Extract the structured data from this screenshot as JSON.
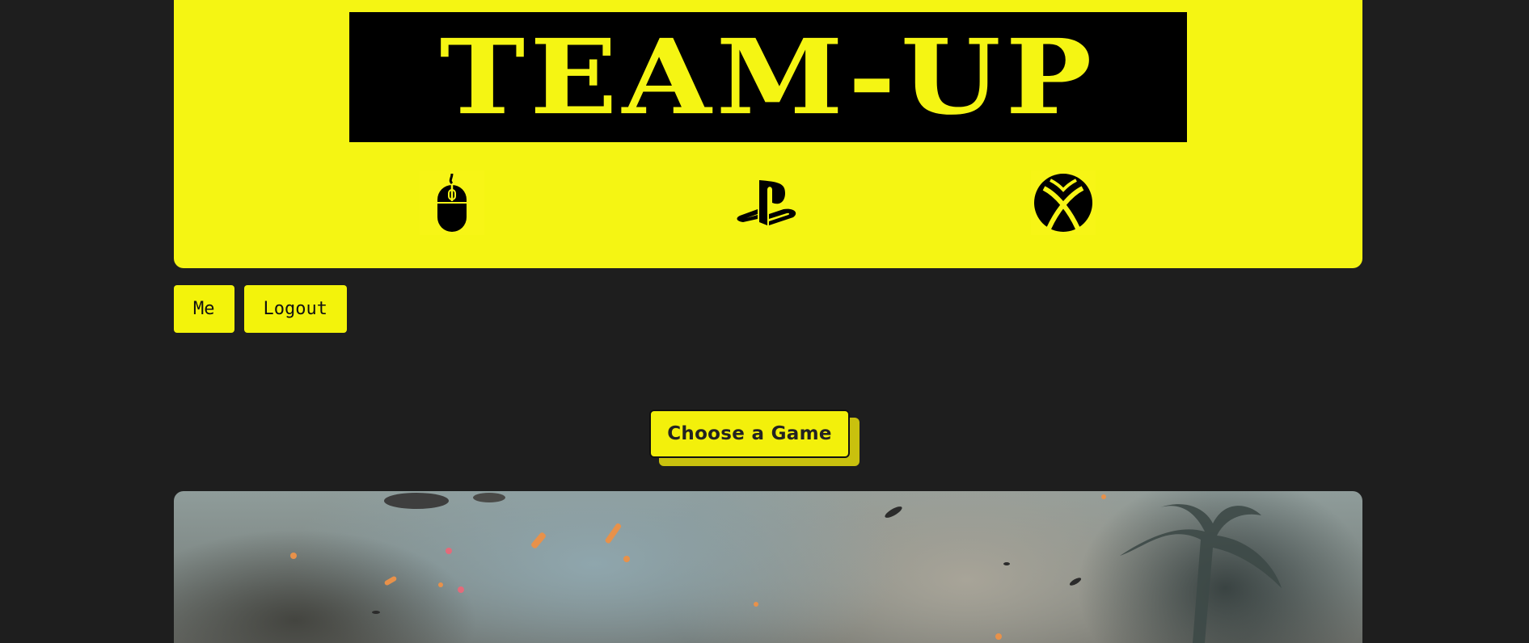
{
  "header": {
    "logo_text": "TEAM-UP",
    "platforms": [
      {
        "name": "pc",
        "icon": "mouse-icon"
      },
      {
        "name": "playstation",
        "icon": "playstation-icon"
      },
      {
        "name": "xbox",
        "icon": "xbox-icon"
      }
    ],
    "colors": {
      "brand_yellow": "#f5f513",
      "logo_bg": "#000000",
      "page_bg": "#1e1e1e"
    }
  },
  "nav": {
    "me_label": "Me",
    "logout_label": "Logout"
  },
  "main": {
    "choose_game_label": "Choose a Game",
    "hero_image": "battle-scene-image"
  }
}
